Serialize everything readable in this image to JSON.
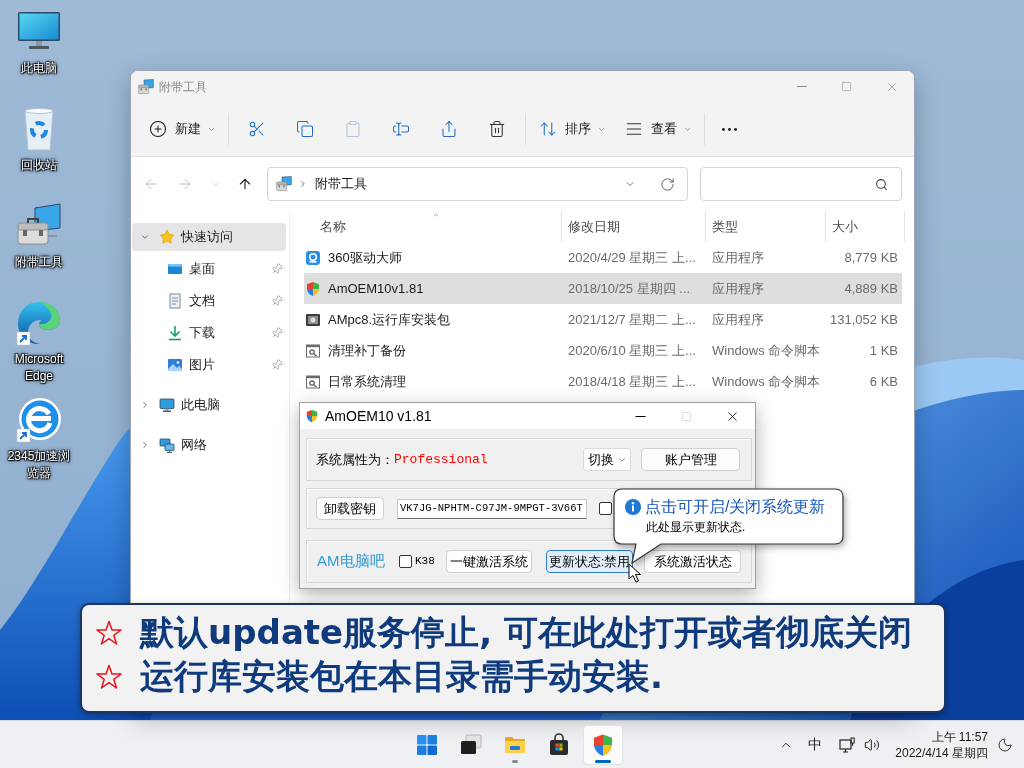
{
  "desktop": {
    "icons": [
      {
        "kind": "computer",
        "label": "此电脑",
        "shortcut": false
      },
      {
        "kind": "recycle-bin",
        "label": "回收站",
        "shortcut": false
      },
      {
        "kind": "toolbox",
        "label": "附带工具",
        "shortcut": false
      },
      {
        "kind": "edge",
        "label": "Microsoft Edge",
        "shortcut": true
      },
      {
        "kind": "e-browser",
        "label": "2345加速浏览器",
        "shortcut": true
      }
    ]
  },
  "explorer": {
    "title": "附带工具",
    "toolbar_groups": [
      {
        "items": [
          {
            "kind": "new",
            "label": "新建",
            "disabled": false
          }
        ]
      },
      {
        "items": [
          {
            "kind": "cut",
            "disabled": false
          },
          {
            "kind": "copy",
            "disabled": false
          },
          {
            "kind": "paste",
            "disabled": true
          },
          {
            "kind": "rename",
            "disabled": false
          },
          {
            "kind": "share",
            "disabled": false
          },
          {
            "kind": "delete",
            "disabled": false
          }
        ]
      },
      {
        "items": [
          {
            "kind": "sort",
            "label": "排序",
            "disabled": false
          },
          {
            "kind": "view",
            "label": "查看",
            "disabled": false
          }
        ]
      },
      {
        "items": [
          {
            "kind": "more",
            "disabled": false
          }
        ]
      }
    ],
    "nav": [
      {
        "kind": "back",
        "disabled": true
      },
      {
        "kind": "forward",
        "disabled": true
      },
      {
        "kind": "recent",
        "disabled": true
      },
      {
        "kind": "up",
        "disabled": false
      }
    ],
    "address": {
      "path": "附带工具"
    },
    "sidebar": {
      "items": [
        {
          "kind": "quick-access",
          "label": "快速访问",
          "expanded": true,
          "selected": true,
          "children": [
            {
              "kind": "desktop",
              "label": "桌面",
              "pinned": true,
              "selected": false
            },
            {
              "kind": "documents",
              "label": "文档",
              "pinned": true,
              "selected": false
            },
            {
              "kind": "downloads",
              "label": "下载",
              "pinned": true,
              "selected": false
            },
            {
              "kind": "pictures",
              "label": "图片",
              "pinned": true,
              "selected": false
            }
          ]
        },
        {
          "kind": "this-pc",
          "label": "此电脑",
          "expanded": false,
          "selected": false
        },
        {
          "kind": "network",
          "label": "网络",
          "expanded": false,
          "selected": false
        }
      ]
    },
    "columns": [
      {
        "label": "名称",
        "sorted": true
      },
      {
        "label": "修改日期",
        "sorted": false
      },
      {
        "label": "类型",
        "sorted": false
      },
      {
        "label": "大小",
        "sorted": false
      }
    ],
    "rows": [
      {
        "kind": "ring-app",
        "name": "360驱动大师",
        "modified": "2020/4/29 星期三 上...",
        "type": "应用程序",
        "size": "8,779 KB",
        "selected": false
      },
      {
        "kind": "shield-app",
        "name": "AmOEM10v1.81",
        "modified": "2018/10/25 星期四 ...",
        "type": "应用程序",
        "size": "4,889 KB",
        "selected": true
      },
      {
        "kind": "installer",
        "name": "AMpc8.运行库安装包",
        "modified": "2021/12/7 星期二 上...",
        "type": "应用程序",
        "size": "131,052 KB",
        "selected": false
      },
      {
        "kind": "script",
        "name": "清理补丁备份",
        "modified": "2020/6/10 星期三 上...",
        "type": "Windows 命令脚本",
        "size": "1 KB",
        "selected": false
      },
      {
        "kind": "script",
        "name": "日常系统清理",
        "modified": "2018/4/18 星期三 上...",
        "type": "Windows 命令脚本",
        "size": "6 KB",
        "selected": false
      }
    ]
  },
  "dialog": {
    "title": "AmOEM10 v1.81",
    "edition_label": "系统属性为：",
    "edition": "Professional",
    "edition_menu": "切换",
    "account_button": "账户管理",
    "unload_key_button": "卸载密钥",
    "product_key": "VK7JG-NPHTM-C97JM-9MPGT-3V66T",
    "extra_option": {
      "checked": false
    },
    "brand": "AM电脑吧",
    "k38": {
      "label": "K38",
      "checked": false
    },
    "actions": [
      {
        "label": "一键激活系统",
        "focused": false
      },
      {
        "label": "更新状态:禁用",
        "focused": true
      },
      {
        "label": "系统激活状态",
        "focused": false
      }
    ],
    "tooltip": {
      "title": "点击可开启/关闭系统更新",
      "text": "此处显示更新状态."
    }
  },
  "banner": {
    "lines": [
      "默认update服务停止, 可在此处打开或者彻底关闭",
      "运行库安装包在本目录需手动安装."
    ]
  },
  "taskbar": {
    "apps": [
      {
        "kind": "start",
        "running": false,
        "active": false
      },
      {
        "kind": "task-view",
        "running": false,
        "active": false
      },
      {
        "kind": "file-explorer",
        "running": true,
        "active": false
      },
      {
        "kind": "store",
        "running": false,
        "active": false
      },
      {
        "kind": "shield-app",
        "running": true,
        "active": true
      }
    ],
    "tray": {
      "ime": "中",
      "time": "上午 11:57",
      "date": "2022/4/14 星期四"
    }
  }
}
